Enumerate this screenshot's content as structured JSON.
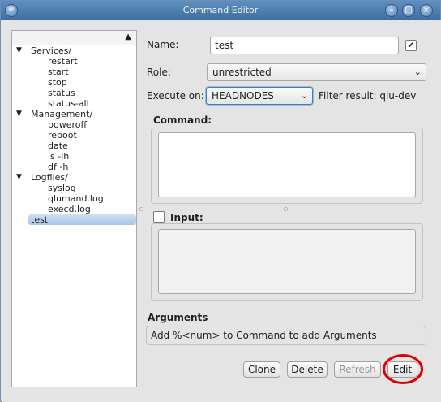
{
  "window": {
    "title": "Command Editor"
  },
  "tree": {
    "items": [
      {
        "label": "Services/",
        "level": 0,
        "expanded": true
      },
      {
        "label": "restart",
        "level": 1
      },
      {
        "label": "start",
        "level": 1
      },
      {
        "label": "stop",
        "level": 1
      },
      {
        "label": "status",
        "level": 1
      },
      {
        "label": "status-all",
        "level": 1
      },
      {
        "label": "Management/",
        "level": 0,
        "expanded": true
      },
      {
        "label": "poweroff",
        "level": 1
      },
      {
        "label": "reboot",
        "level": 1
      },
      {
        "label": "date",
        "level": 1
      },
      {
        "label": "ls -lh",
        "level": 1
      },
      {
        "label": "df -h",
        "level": 1
      },
      {
        "label": "Logfiles/",
        "level": 0,
        "expanded": true
      },
      {
        "label": "syslog",
        "level": 1
      },
      {
        "label": "qlumand.log",
        "level": 1
      },
      {
        "label": "execd.log",
        "level": 1
      },
      {
        "label": "test",
        "level": 0,
        "selected": true
      }
    ]
  },
  "form": {
    "name_label": "Name:",
    "name_value": "test",
    "name_checked": true,
    "role_label": "Role:",
    "role_value": "unrestricted",
    "execute_label": "Execute on:",
    "execute_value": "HEADNODES",
    "filter_result": "Filter result: qlu-dev",
    "command_label": "Command:",
    "input_label": "Input:",
    "input_checked": false,
    "arguments_label": "Arguments",
    "arguments_hint": "Add %<num> to Command to add Arguments"
  },
  "buttons": {
    "clone": "Clone",
    "delete": "Delete",
    "refresh": "Refresh",
    "edit": "Edit"
  },
  "colors": {
    "titlebar": "#4f7fb0",
    "highlight_ring": "#e00000",
    "selection": "#a9c6e5"
  }
}
